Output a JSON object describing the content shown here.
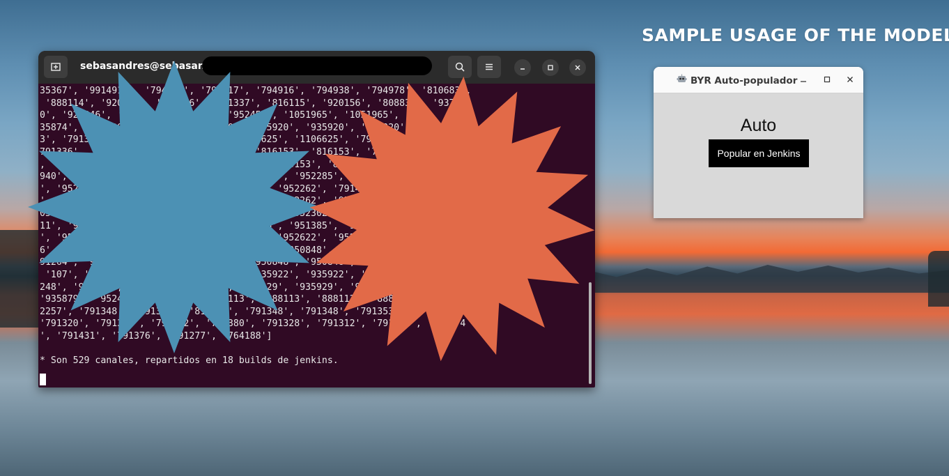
{
  "headline": "SAMPLE USAGE OF THE MODEL",
  "terminal": {
    "title": "sebasandres@sebasandre",
    "icons": {
      "new_tab": "new-tab-icon",
      "search": "search-icon",
      "menu": "hamburger-menu-icon",
      "minimize": "minimize-icon",
      "maximize": "maximize-icon",
      "close": "close-icon"
    },
    "output_lines": [
      "35367', '9914914', '794914', '794917', '794916', '794938', '794978', '810683',",
      " '888114', '920156', '920156', '791337', '816115', '920156', '808831', '93744",
      "0', '920846', '920846', '952456', '952456', '1051965', '1051965', '9",
      "35874', '935920', '935920', '935920', '935920', '935920', '935920', '76412",
      "3', '791336', '791336', '1106625', '1106625', '1106625', '791441', '",
      "791336', '791336', '816153', '816153', '816153', '816153', '793091',",
      ", '816153', '816153', '816153', '816153', '816153', '816153', '94",
      "940', '952285', '952285', '952285', '952285', '952285', '952285', '",
      "', '952262', '952262', '952262', '952262', '952262', '791441',",
      "', '952262', '952262', '952262', '952262', '952262', '952262', '",
      "05', '952302', '952302', '952302', '952302', '952302', '952302', '9",
      "11', '951385', '951385', '951385', '951385', '951385', '951385', '5',",
      "', '952622', '952622', '952622', '952622', '952622', '952622', '930",
      "6', '950848', '950848', '950848', '950848', '950848', '950848', '",
      "91264', '950848', '950848', '950848', '950848', '950848', '950848', '437',",
      " '107', '935922', '935922', '935922', '935922', '935922', '935922', '95",
      "248', '935929', '935929', '935929', '935929', '935929', '935929', '8',",
      "'935879', '952480', '952480', '888113', '888113', '888113', '888123', '107",
      "2257', '791348', '791348', '816153', '791348', '791348', '791353',",
      "'791320', '791312', '791312', '791380', '791328', '791312', '791312', '791274",
      "', '791431', '791376', '791277', '764188']",
      "",
      "* Son 529 canales, repartidos en 18 builds de jenkins."
    ]
  },
  "app_window": {
    "title": "BYR Auto-populador",
    "title_icon": "robot-icon",
    "heading": "Auto",
    "button_label": "Popular en Jenkins",
    "controls": {
      "minimize": "minimize-icon",
      "maximize": "maximize-icon",
      "close": "close-icon"
    }
  },
  "colors": {
    "terminal_bg": "#300a24",
    "star_blue": "#4c91b4",
    "star_orange": "#e26a48",
    "app_bg": "#d9d9d9",
    "button_bg": "#000000"
  }
}
